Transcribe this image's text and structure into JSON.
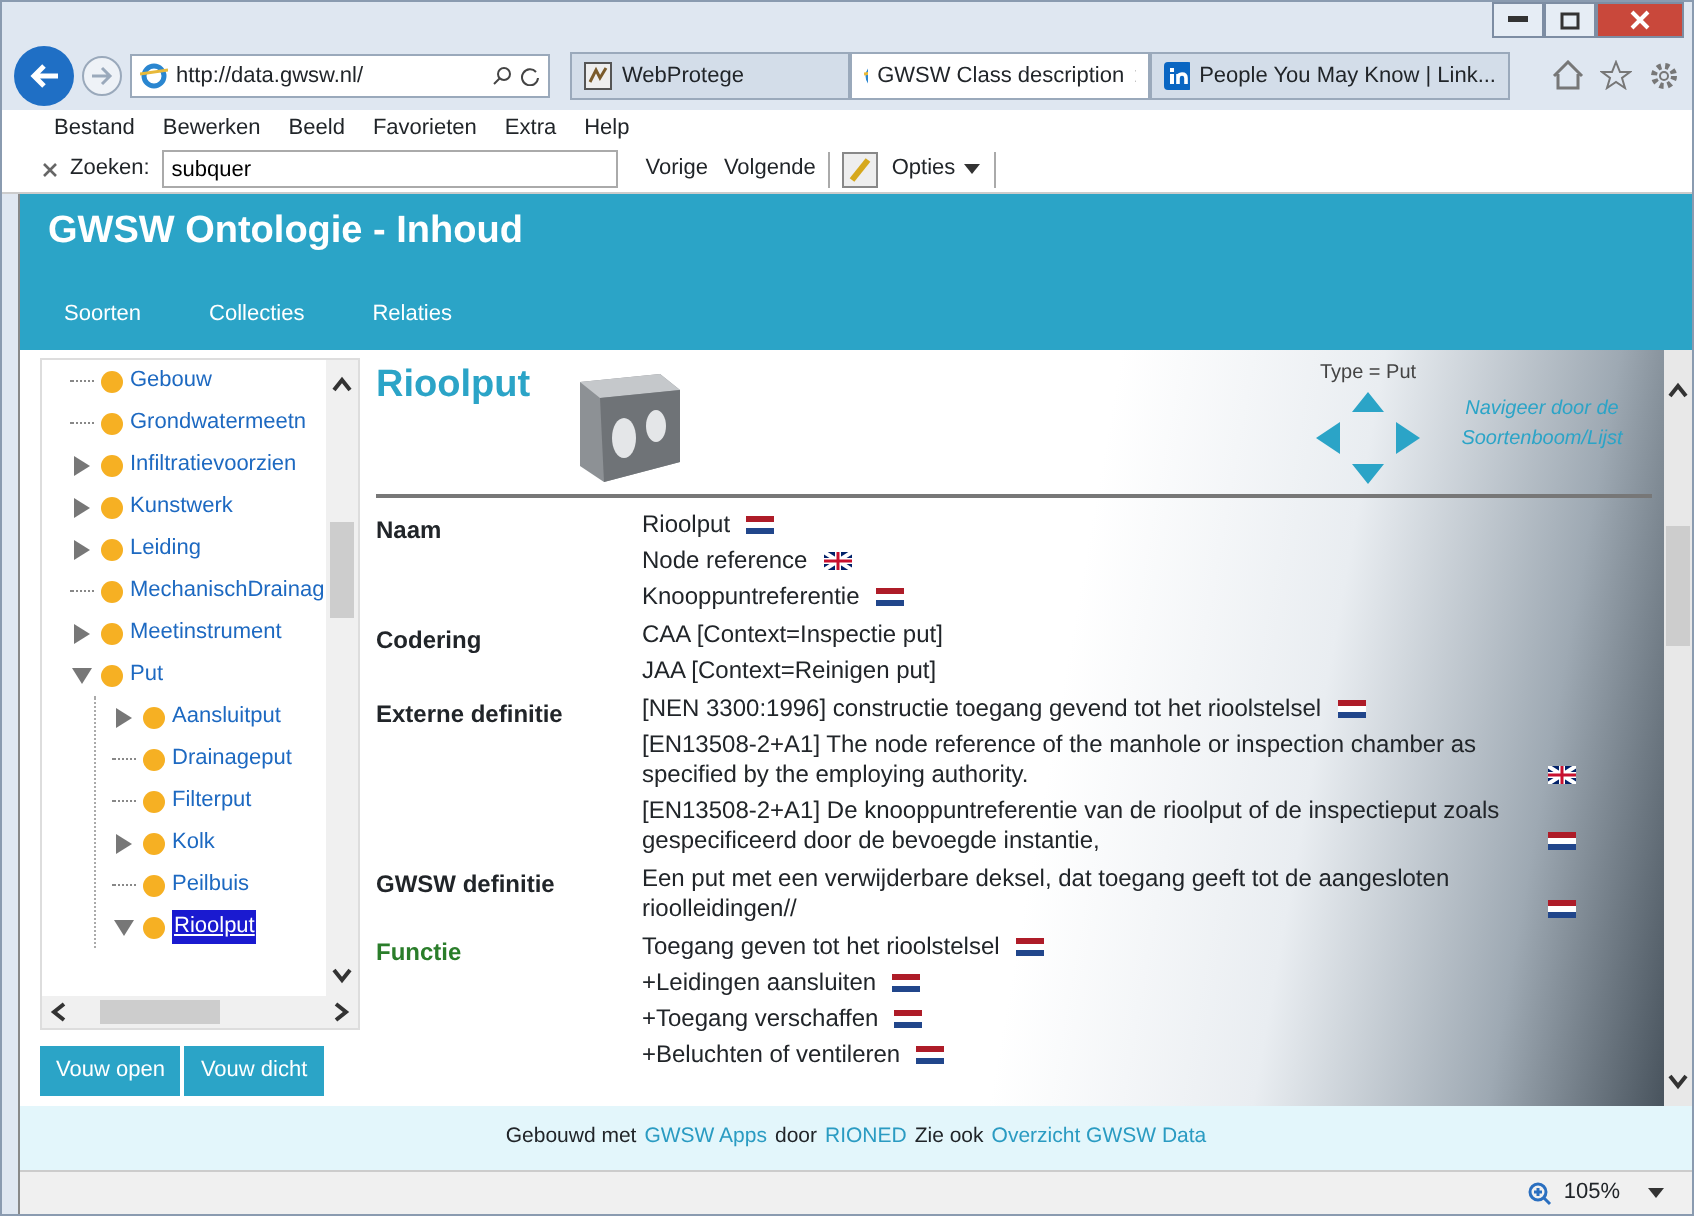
{
  "browser": {
    "address": "http://data.gwsw.nl/",
    "tabs": [
      {
        "label": "WebProtege",
        "selected": false
      },
      {
        "label": "GWSW Class description",
        "selected": true
      },
      {
        "label": "People You May Know | Link...",
        "selected": false
      }
    ],
    "menu": [
      "Bestand",
      "Bewerken",
      "Beeld",
      "Favorieten",
      "Extra",
      "Help"
    ],
    "find": {
      "label": "Zoeken:",
      "value": "subquer",
      "buttons": [
        "Vorige",
        "Volgende"
      ],
      "options": "Opties"
    },
    "zoom": "105%"
  },
  "app": {
    "title": "GWSW Ontologie - Inhoud",
    "nav": [
      "Soorten",
      "Collecties",
      "Relaties"
    ]
  },
  "tree": [
    {
      "label": "Gebouw",
      "expandable": false,
      "expanded": false,
      "selected": false
    },
    {
      "label": "Grondwatermeetn",
      "expandable": false,
      "expanded": false,
      "selected": false
    },
    {
      "label": "Infiltratievoorzien",
      "expandable": true,
      "expanded": false,
      "selected": false
    },
    {
      "label": "Kunstwerk",
      "expandable": true,
      "expanded": false,
      "selected": false
    },
    {
      "label": "Leiding",
      "expandable": true,
      "expanded": false,
      "selected": false
    },
    {
      "label": "MechanischDrainag",
      "expandable": false,
      "expanded": false,
      "selected": false
    },
    {
      "label": "Meetinstrument",
      "expandable": true,
      "expanded": false,
      "selected": false
    },
    {
      "label": "Put",
      "expandable": true,
      "expanded": true,
      "selected": false,
      "children": [
        {
          "label": "Aansluitput",
          "expandable": true,
          "expanded": false,
          "selected": false
        },
        {
          "label": "Drainageput",
          "expandable": false,
          "expanded": false,
          "selected": false
        },
        {
          "label": "Filterput",
          "expandable": false,
          "expanded": false,
          "selected": false
        },
        {
          "label": "Kolk",
          "expandable": true,
          "expanded": false,
          "selected": false
        },
        {
          "label": "Peilbuis",
          "expandable": false,
          "expanded": false,
          "selected": false
        },
        {
          "label": "Rioolput",
          "expandable": true,
          "expanded": true,
          "selected": true
        }
      ]
    }
  ],
  "tree_buttons": [
    "Vouw open",
    "Vouw dicht"
  ],
  "detail": {
    "title": "Rioolput",
    "type": "Type = Put",
    "navigate": "Navigeer door de Soortenboom/Lijst",
    "properties": [
      {
        "label": "Naam",
        "kind": "plain",
        "values": [
          {
            "text": "Rioolput",
            "kind": "dutch"
          },
          {
            "text": "Node reference",
            "kind": "english"
          },
          {
            "text": "Knooppuntreferentie",
            "kind": "dutch"
          }
        ]
      },
      {
        "label": "Codering",
        "kind": "plain",
        "values": [
          {
            "text": "CAA [Context=Inspectie put]",
            "kind": "plain"
          },
          {
            "text": "JAA [Context=Reinigen put]",
            "kind": "plain"
          }
        ]
      },
      {
        "label": "Externe definitie",
        "kind": "plain",
        "values": [
          {
            "text": "[NEN 3300:1996] constructie toegang gevend tot het rioolstelsel",
            "kind": "dutch"
          },
          {
            "text": "[EN13508-2+A1] The node reference of the manhole or inspection chamber as specified by the employing authority.",
            "kind": "english"
          },
          {
            "text": "[EN13508-2+A1] De knooppuntreferentie van de rioolput of de inspectieput zoals gespecificeerd door de bevoegde instantie,",
            "kind": "dutch"
          }
        ]
      },
      {
        "label": "GWSW definitie",
        "kind": "plain",
        "values": [
          {
            "text": "Een put met een verwijderbare deksel, dat toegang geeft tot de aangesloten rioolleidingen//",
            "kind": "dutch"
          }
        ]
      },
      {
        "label": "Functie",
        "kind": "function",
        "values": [
          {
            "text": "Toegang geven tot het rioolstelsel",
            "kind": "dutch"
          },
          {
            "text": "+Leidingen aansluiten",
            "kind": "dutch"
          },
          {
            "text": "+Toegang verschaffen",
            "kind": "dutch"
          },
          {
            "text": "+Beluchten of ventileren",
            "kind": "dutch"
          }
        ]
      }
    ]
  },
  "footer": [
    {
      "text": "Gebouwd met",
      "kind": "text"
    },
    {
      "text": "GWSW Apps",
      "kind": "link"
    },
    {
      "text": "door",
      "kind": "text"
    },
    {
      "text": "RIONED",
      "kind": "link"
    },
    {
      "text": "Zie ook",
      "kind": "text"
    },
    {
      "text": "Overzicht GWSW Data",
      "kind": "link"
    }
  ]
}
